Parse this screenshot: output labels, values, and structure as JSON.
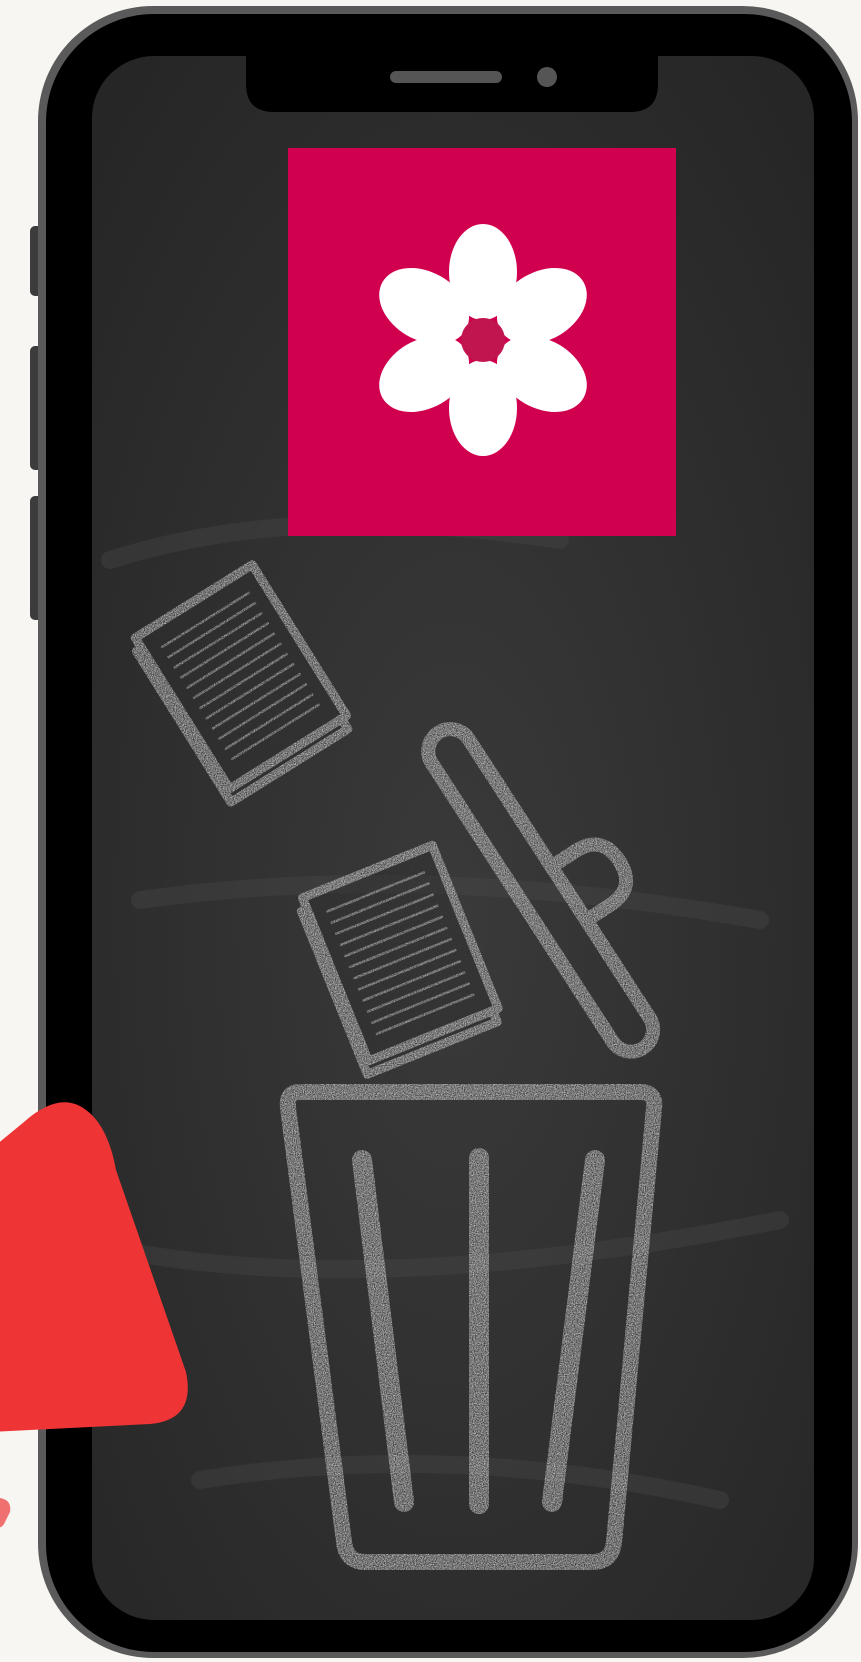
{
  "scene": {
    "description_free": true,
    "colors": {
      "background": "#f7f6f2",
      "phone_bezel": "#5a5a5a",
      "phone_frame": "#000000",
      "chalkboard": "#2f2f2f",
      "chalk": "#c9c9c9",
      "app_icon_bg": "#d1004f",
      "flower_petals": "#ffffff",
      "flower_center": "#c0154e",
      "pointer_arrow": "#ee3434"
    },
    "icons": {
      "app_icon": "flower-app-icon",
      "trash": "trash-can-icon",
      "trash_lid": "trash-lid-icon",
      "papers": "paper-sheet-icon",
      "pointer": "pointer-arrow-icon"
    }
  }
}
